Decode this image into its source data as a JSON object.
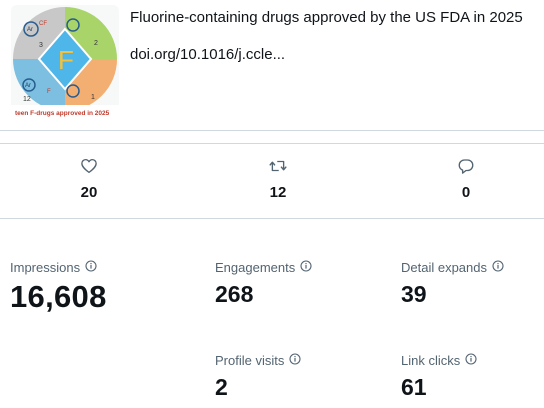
{
  "link_card": {
    "title": "Fluorine-containing drugs approved by the US FDA in 2025",
    "domain": "doi.org/10.1016/j.ccle...",
    "thumbnail": {
      "labels": {
        "ar_cf3": "Ar",
        "cf3": "CF",
        "count_3": "3",
        "count_2": "2",
        "count_12": "12",
        "count_1": "1",
        "ar_f": "Ar",
        "f_x": "F",
        "letter_f": "F",
        "banner": "teen F-drugs approved in 2025"
      },
      "colors": [
        "#b9dc7a",
        "#9ed06a",
        "#7bbfde",
        "#f2ae70",
        "#c9c9c9"
      ]
    }
  },
  "engagement": [
    {
      "icon": "heart-icon",
      "count": "20"
    },
    {
      "icon": "retweet-icon",
      "count": "12"
    },
    {
      "icon": "reply-icon",
      "count": "0"
    }
  ],
  "metrics": {
    "impressions": {
      "label": "Impressions",
      "value": "16,608"
    },
    "engagements": {
      "label": "Engagements",
      "value": "268"
    },
    "detail_expands": {
      "label": "Detail expands",
      "value": "39"
    },
    "profile_visits": {
      "label": "Profile visits",
      "value": "2"
    },
    "link_clicks": {
      "label": "Link clicks",
      "value": "61"
    }
  }
}
